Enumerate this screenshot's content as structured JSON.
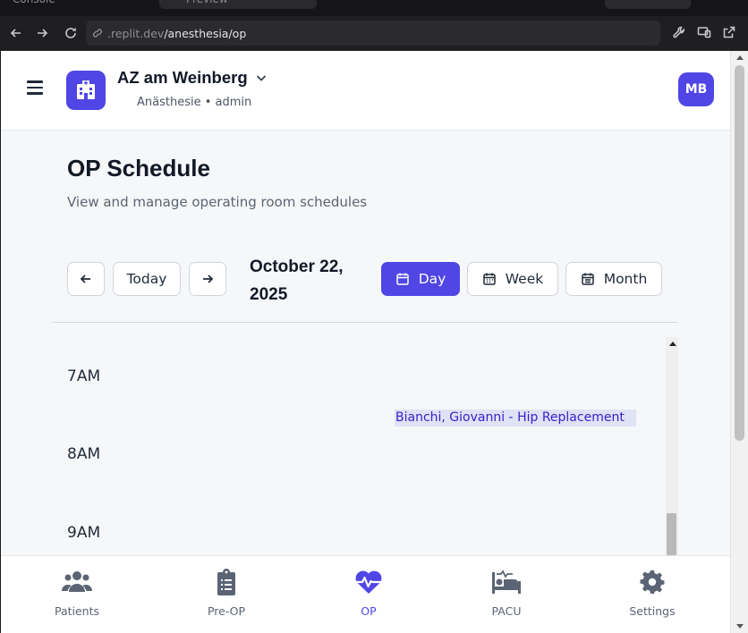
{
  "browser": {
    "tab_fragments": [
      "Console",
      "Preview"
    ],
    "url_host": ".replit.dev",
    "url_path": "/anesthesia/op"
  },
  "header": {
    "org_name": "AZ am Weinberg",
    "role": "Anästhesie • admin",
    "avatar_initials": "MB"
  },
  "page": {
    "title": "OP Schedule",
    "subtitle": "View and manage operating room schedules"
  },
  "controls": {
    "prev_icon": "arrow-left-icon",
    "today_label": "Today",
    "next_icon": "arrow-right-icon",
    "date_line1": "October 22,",
    "date_line2": "2025",
    "views": [
      {
        "label": "Day",
        "active": true
      },
      {
        "label": "Week",
        "active": false
      },
      {
        "label": "Month",
        "active": false
      }
    ]
  },
  "calendar": {
    "times": [
      "7AM",
      "8AM",
      "9AM"
    ],
    "events": [
      {
        "label": "Bianchi, Giovanni - Hip Replacement"
      }
    ]
  },
  "bottom_nav": [
    {
      "label": "Patients",
      "icon": "users-icon",
      "active": false
    },
    {
      "label": "Pre-OP",
      "icon": "clipboard-icon",
      "active": false
    },
    {
      "label": "OP",
      "icon": "heartbeat-icon",
      "active": true
    },
    {
      "label": "PACU",
      "icon": "bed-icon",
      "active": false
    },
    {
      "label": "Settings",
      "icon": "gear-icon",
      "active": false
    }
  ],
  "colors": {
    "accent": "#4f46e5",
    "event_bg": "#e0e2f5",
    "event_text": "#3b1ecf"
  }
}
